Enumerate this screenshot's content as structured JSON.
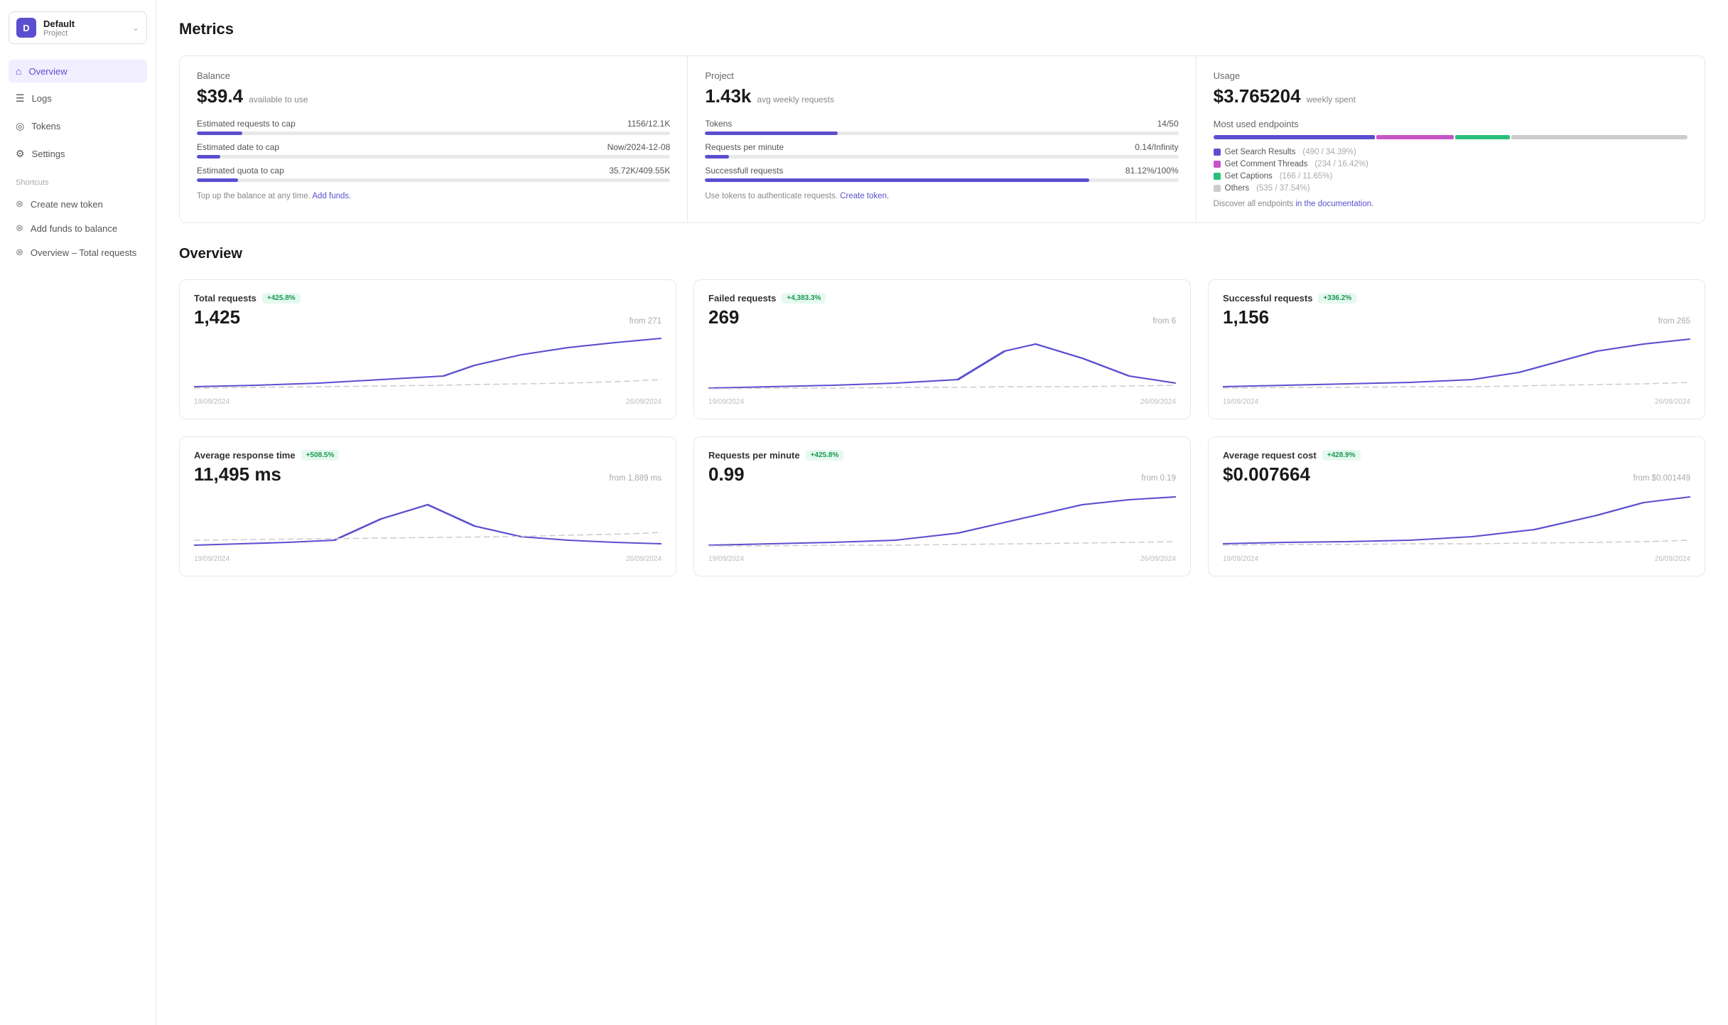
{
  "sidebar": {
    "project": {
      "icon": "D",
      "name": "Default",
      "sub": "Project"
    },
    "nav": [
      {
        "id": "overview",
        "label": "Overview",
        "icon": "⌂",
        "active": true
      },
      {
        "id": "logs",
        "label": "Logs",
        "icon": "☰",
        "active": false
      },
      {
        "id": "tokens",
        "label": "Tokens",
        "icon": "◎",
        "active": false
      },
      {
        "id": "settings",
        "label": "Settings",
        "icon": "⚙",
        "active": false
      }
    ],
    "shortcuts_label": "Shortcuts",
    "shortcuts": [
      {
        "id": "create-token",
        "label": "Create new token",
        "icon": "⟳"
      },
      {
        "id": "add-funds",
        "label": "Add funds to balance",
        "icon": "⟳"
      },
      {
        "id": "total-requests",
        "label": "Overview – Total requests",
        "icon": "⟳"
      }
    ]
  },
  "metrics": {
    "title": "Metrics",
    "balance": {
      "label": "Balance",
      "value": "$39.4",
      "sub": "available to use",
      "stats": [
        {
          "label": "Estimated requests to cap",
          "current": "1156",
          "max": "12.1K",
          "pct": 9.6
        },
        {
          "label": "Estimated date to cap",
          "current": "Now",
          "max": "2024-12-08",
          "pct": 5
        },
        {
          "label": "Estimated quota to cap",
          "current": "35.72K",
          "max": "409.55K",
          "pct": 8.7
        }
      ],
      "footer": "Top up the balance at any time.",
      "footer_link": "Add funds.",
      "footer_link_href": "#"
    },
    "project": {
      "label": "Project",
      "value": "1.43k",
      "sub": "avg weekly requests",
      "stats": [
        {
          "label": "Tokens",
          "current": "14",
          "max": "50",
          "pct": 28
        },
        {
          "label": "Requests per minute",
          "current": "0.14",
          "max": "Infinity",
          "pct": 5
        },
        {
          "label": "Successfull requests",
          "current": "81.12%",
          "max": "100%",
          "pct": 81
        }
      ],
      "footer": "Use tokens to authenticate requests.",
      "footer_link": "Create token.",
      "footer_link_href": "#"
    },
    "usage": {
      "label": "Usage",
      "value": "$3.765204",
      "sub": "weekly spent",
      "most_used_label": "Most used endpoints",
      "endpoints": [
        {
          "label": "Get Search Results",
          "detail": "490 / 34.39%",
          "color": "#5b4fcf",
          "pct": 34.39
        },
        {
          "label": "Get Comment Threads",
          "detail": "234 / 16.42%",
          "color": "#c855c8",
          "pct": 16.42
        },
        {
          "label": "Get Captions",
          "detail": "166 / 11.65%",
          "color": "#2abf7a",
          "pct": 11.65
        },
        {
          "label": "Others",
          "detail": "535 / 37.54%",
          "color": "#cccccc",
          "pct": 37.54
        }
      ],
      "footer": "Discover all endpoints",
      "footer_link": "in the documentation.",
      "footer_link_href": "#"
    }
  },
  "overview": {
    "title": "Overview",
    "charts": [
      {
        "id": "total-requests",
        "title": "Total requests",
        "badge": "+425.8%",
        "value": "1,425",
        "from": "from 271",
        "date_start": "19/09/2024",
        "date_end": "26/09/2024"
      },
      {
        "id": "failed-requests",
        "title": "Failed requests",
        "badge": "+4,383.3%",
        "value": "269",
        "from": "from 6",
        "date_start": "19/09/2024",
        "date_end": "26/09/2024"
      },
      {
        "id": "successful-requests",
        "title": "Successful requests",
        "badge": "+336.2%",
        "value": "1,156",
        "from": "from 265",
        "date_start": "19/09/2024",
        "date_end": "26/09/2024"
      },
      {
        "id": "avg-response-time",
        "title": "Average response time",
        "badge": "+508.5%",
        "value": "11,495 ms",
        "from": "from 1,889 ms",
        "date_start": "19/09/2024",
        "date_end": "26/09/2024"
      },
      {
        "id": "requests-per-minute",
        "title": "Requests per minute",
        "badge": "+425.8%",
        "value": "0.99",
        "from": "from 0.19",
        "date_start": "19/09/2024",
        "date_end": "26/09/2024"
      },
      {
        "id": "avg-request-cost",
        "title": "Average request cost",
        "badge": "+428.9%",
        "value": "$0.007664",
        "from": "from $0.001449",
        "date_start": "19/09/2024",
        "date_end": "26/09/2024"
      }
    ]
  }
}
